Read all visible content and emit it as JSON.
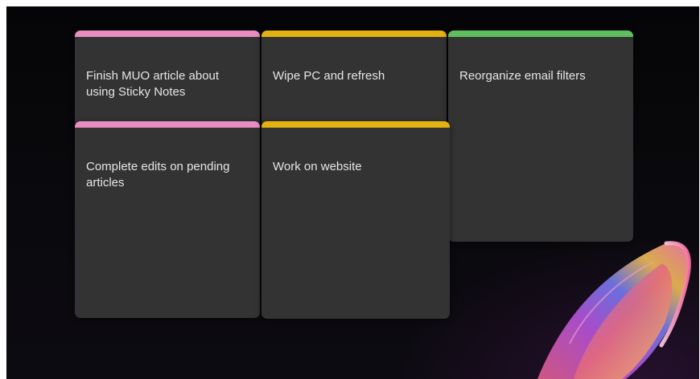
{
  "colors": {
    "pink": "#e98cc0",
    "yellow": "#e3b211",
    "green": "#5fbf5f",
    "note_bg": "#333333",
    "desktop_bg": "#07070a"
  },
  "notes": [
    {
      "text": "Finish MUO article about using Sticky Notes",
      "color": "pink"
    },
    {
      "text": "Wipe PC and refresh",
      "color": "yellow"
    },
    {
      "text": "Reorganize email filters",
      "color": "green"
    },
    {
      "text": "Complete edits on pending articles",
      "color": "pink"
    },
    {
      "text": "Work on website",
      "color": "yellow"
    }
  ],
  "wallpaper": {
    "icon": "windows-11-bloom"
  }
}
